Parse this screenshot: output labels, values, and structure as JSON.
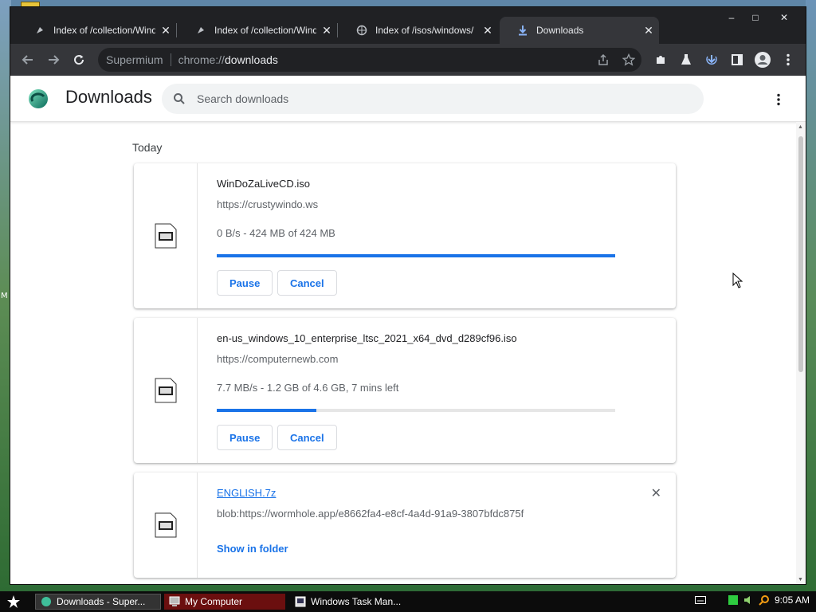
{
  "desktop": {
    "edge_letter": "M"
  },
  "tabs": [
    {
      "title": "Index of /collection/Window",
      "close": "✕"
    },
    {
      "title": "Index of /collection/Window",
      "close": "✕"
    },
    {
      "title": "Index of /isos/windows/",
      "close": "✕"
    },
    {
      "title": "Downloads",
      "close": "✕"
    }
  ],
  "window_controls": {
    "minimize": "–",
    "maximize": "□",
    "close": "✕"
  },
  "omnibox": {
    "site": "Supermium",
    "url_scheme": "chrome://",
    "url_host": "downloads"
  },
  "page": {
    "title": "Downloads",
    "search_placeholder": "Search downloads",
    "section": "Today"
  },
  "downloads": [
    {
      "name": "WinDoZaLiveCD.iso",
      "url": "https://crustywindo.ws",
      "status": "0 B/s - 424 MB of 424 MB",
      "progress": 1.0,
      "pause": "Pause",
      "cancel": "Cancel"
    },
    {
      "name": "en-us_windows_10_enterprise_ltsc_2021_x64_dvd_d289cf96.iso",
      "url": "https://computernewb.com",
      "status": "7.7 MB/s - 1.2 GB of 4.6 GB, 7 mins left",
      "progress": 0.25,
      "pause": "Pause",
      "cancel": "Cancel"
    },
    {
      "name": "ENGLISH.7z",
      "url": "blob:https://wormhole.app/e8662fa4-e8cf-4a4d-91a9-3807bfdc875f",
      "action": "Show in folder"
    }
  ],
  "taskbar": {
    "items": [
      "Downloads - Super...",
      "My Computer",
      "Windows Task Man..."
    ],
    "clock": "9:05 AM"
  },
  "colors": {
    "accent": "#1a73e8",
    "tab_bg": "#202124",
    "toolbar_bg": "#35363a"
  }
}
